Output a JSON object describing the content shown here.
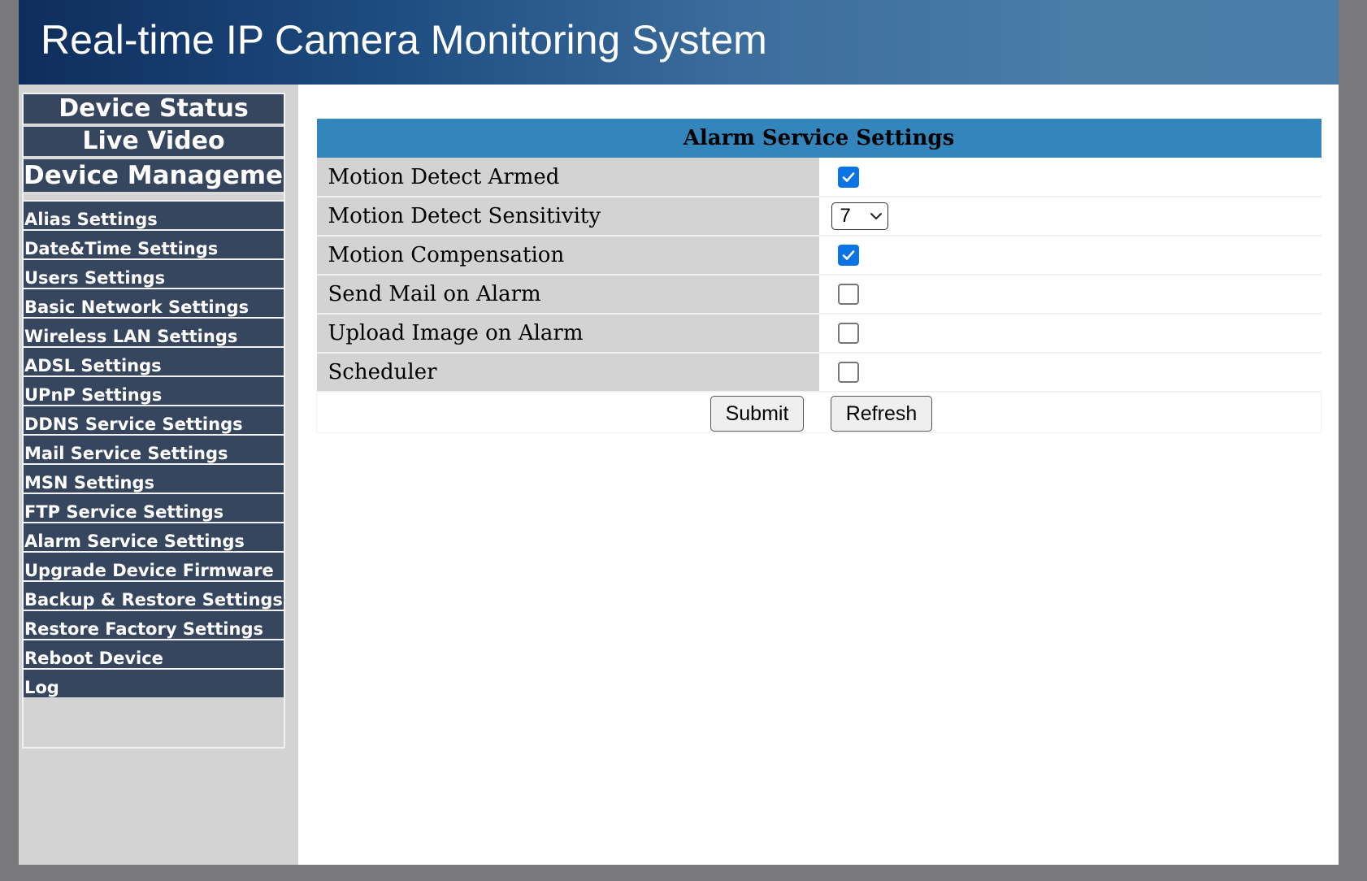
{
  "header": {
    "title": "Real-time IP Camera Monitoring System"
  },
  "sidebar": {
    "top_items": [
      {
        "label": "Device Status"
      },
      {
        "label": "Live Video"
      },
      {
        "label": "Device Management"
      }
    ],
    "items": [
      {
        "label": "Alias Settings"
      },
      {
        "label": "Date&Time Settings"
      },
      {
        "label": "Users Settings"
      },
      {
        "label": "Basic Network Settings"
      },
      {
        "label": "Wireless LAN Settings"
      },
      {
        "label": "ADSL Settings"
      },
      {
        "label": "UPnP Settings"
      },
      {
        "label": "DDNS Service Settings"
      },
      {
        "label": "Mail Service Settings"
      },
      {
        "label": "MSN Settings"
      },
      {
        "label": "FTP Service Settings"
      },
      {
        "label": "Alarm Service Settings"
      },
      {
        "label": "Upgrade Device Firmware"
      },
      {
        "label": "Backup & Restore Settings"
      },
      {
        "label": "Restore Factory Settings"
      },
      {
        "label": "Reboot Device"
      },
      {
        "label": "Log"
      }
    ]
  },
  "form": {
    "title": "Alarm Service Settings",
    "rows": [
      {
        "label": "Motion Detect Armed",
        "type": "checkbox",
        "checked": true
      },
      {
        "label": "Motion Detect Sensitivity",
        "type": "select",
        "value": "7"
      },
      {
        "label": "Motion Compensation",
        "type": "checkbox",
        "checked": true
      },
      {
        "label": "Send Mail on Alarm",
        "type": "checkbox",
        "checked": false
      },
      {
        "label": "Upload Image on Alarm",
        "type": "checkbox",
        "checked": false
      },
      {
        "label": "Scheduler",
        "type": "checkbox",
        "checked": false
      }
    ],
    "submit_label": "Submit",
    "refresh_label": "Refresh"
  },
  "colors": {
    "header_gradient_start": "#0e2d5c",
    "header_gradient_end": "#4a7da9",
    "nav_background": "#36465f",
    "table_header": "#3286bb",
    "label_cell": "#d3d3d3",
    "checkbox_checked": "#0a74e6",
    "page_background": "#7a797c"
  }
}
